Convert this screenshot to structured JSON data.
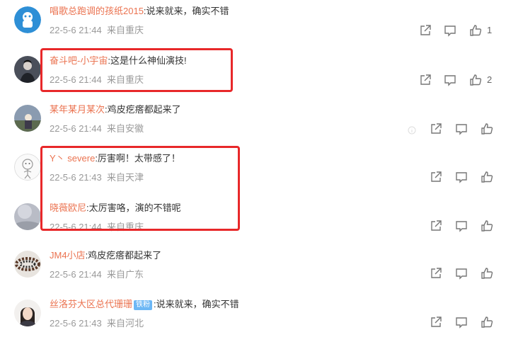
{
  "comments": [
    {
      "user": "唱歌总跑调的孩纸2015",
      "text": ":说来就来，确实不错",
      "time": "22-5-6 21:44",
      "location": "来自重庆",
      "likes": "1"
    },
    {
      "user": "奋斗吧-小宇宙",
      "text": ":这是什么神仙演技!",
      "time": "22-5-6 21:44",
      "location": "来自重庆",
      "likes": "2"
    },
    {
      "user": "某年某月某次",
      "text": ":鸡皮疙瘩都起来了",
      "time": "22-5-6 21:44",
      "location": "来自安徽",
      "likes": ""
    },
    {
      "user": "Y丶 severe",
      "text": ":厉害啊！太带感了！",
      "time": "22-5-6 21:43",
      "location": "来自天津",
      "likes": ""
    },
    {
      "user": "晓薇欧尼",
      "text": ":太厉害咯，演的不错呢",
      "time": "22-5-6 21:44",
      "location": "来自重庆",
      "likes": ""
    },
    {
      "user": "JM4小店",
      "text": ":鸡皮疙瘩都起来了",
      "time": "22-5-6 21:44",
      "location": "来自广东",
      "likes": ""
    },
    {
      "user": "丝洛芬大区总代珊珊",
      "badge": "铁粉",
      "text": ":说来就来，确实不错",
      "time": "22-5-6 21:43",
      "location": "来自河北",
      "likes": ""
    }
  ],
  "colors": {
    "username": "#eb7350",
    "highlight": "#e8282a",
    "badge": "#6cb7f5"
  },
  "icons": {
    "share": "share-icon",
    "comment": "comment-icon",
    "like": "like-icon"
  }
}
